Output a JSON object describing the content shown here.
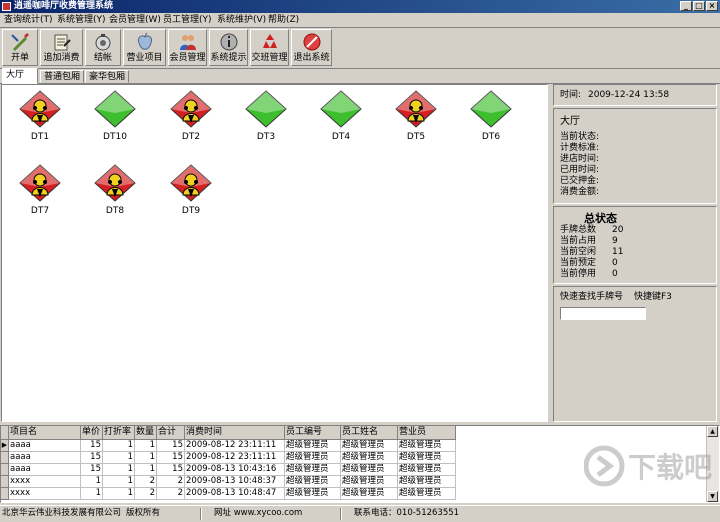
{
  "window": {
    "title": "逍遥咖啡厅收费管理系统",
    "buttons": [
      {
        "icon": "minimize-icon",
        "glyph": "_"
      },
      {
        "icon": "maximize-icon",
        "glyph": "□"
      },
      {
        "icon": "close-icon",
        "glyph": "×"
      }
    ]
  },
  "menu": [
    "查询统计(T)",
    "系统管理(Y)",
    "会员管理(W)",
    "员工管理(Y)",
    "系统维护(V)",
    "帮助(Z)"
  ],
  "toolbar": [
    {
      "label": "开单",
      "icon": "open-bill-icon"
    },
    {
      "label": "追加消费",
      "icon": "add-consume-icon"
    },
    {
      "label": "结帐",
      "icon": "checkout-icon"
    },
    {
      "label": "营业项目",
      "icon": "business-items-icon"
    },
    {
      "label": "会员管理",
      "icon": "members-icon"
    },
    {
      "label": "系统提示",
      "icon": "system-hint-icon"
    },
    {
      "label": "交班管理",
      "icon": "shift-handover-icon"
    },
    {
      "label": "退出系统",
      "icon": "exit-icon"
    }
  ],
  "tabs": [
    {
      "label": "大厅",
      "active": true
    },
    {
      "label": "普通包厢",
      "active": false
    },
    {
      "label": "豪华包厢",
      "active": false
    }
  ],
  "tables": [
    {
      "name": "DT1",
      "status": "occupied"
    },
    {
      "name": "DT10",
      "status": "free"
    },
    {
      "name": "DT2",
      "status": "occupied"
    },
    {
      "name": "DT3",
      "status": "free"
    },
    {
      "name": "DT4",
      "status": "free"
    },
    {
      "name": "DT5",
      "status": "occupied"
    },
    {
      "name": "DT6",
      "status": "free"
    },
    {
      "name": "DT7",
      "status": "occupied"
    },
    {
      "name": "DT8",
      "status": "occupied"
    },
    {
      "name": "DT9",
      "status": "occupied"
    }
  ],
  "colors": {
    "occupied": "#d42020",
    "free": "#3fbf2f",
    "titlebar": "#0a246a"
  },
  "info": {
    "time_label": "时间:",
    "time_value": "2009-12-24 13:58",
    "area_title": "大厅",
    "fields": [
      "当前状态:",
      "计费标准:",
      "进店时间:",
      "已用时间:",
      "已交押金:",
      "消费金额:"
    ]
  },
  "status": {
    "title": "总状态",
    "items": [
      {
        "label": "手牌总数",
        "value": "20"
      },
      {
        "label": "当前占用",
        "value": "9"
      },
      {
        "label": "当前空闲",
        "value": "11"
      },
      {
        "label": "当前预定",
        "value": "0"
      },
      {
        "label": "当前停用",
        "value": "0"
      }
    ]
  },
  "search": {
    "label": "快速查找手牌号",
    "shortcut": "快捷键F3",
    "value": ""
  },
  "grid": {
    "columns": [
      "项目名",
      "单价",
      "打折率",
      "数量",
      "合计",
      "消费时间",
      "员工编号",
      "员工姓名",
      "营业员"
    ],
    "rows": [
      [
        "aaaa",
        "15",
        "1",
        "1",
        "15",
        "2009-08-12 23:11:11",
        "超级管理员",
        "超级管理员",
        "超级管理员"
      ],
      [
        "aaaa",
        "15",
        "1",
        "1",
        "15",
        "2009-08-12 23:11:11",
        "超级管理员",
        "超级管理员",
        "超级管理员"
      ],
      [
        "aaaa",
        "15",
        "1",
        "1",
        "15",
        "2009-08-13 10:43:16",
        "超级管理员",
        "超级管理员",
        "超级管理员"
      ],
      [
        "xxxx",
        "1",
        "1",
        "2",
        "2",
        "2009-08-13 10:48:37",
        "超级管理员",
        "超级管理员",
        "超级管理员"
      ],
      [
        "xxxx",
        "1",
        "1",
        "2",
        "2",
        "2009-08-13 10:48:47",
        "超级管理员",
        "超级管理员",
        "超级管理员"
      ]
    ]
  },
  "statusbar": {
    "company": "北京华云伟业科技发展有限公司",
    "rights": "版权所有",
    "website": "网址 www.xycoo.com",
    "phone": "联系电话：010-51263551"
  },
  "watermark": {
    "text": "下载吧",
    "icon": "xiazaiba-logo-icon"
  }
}
